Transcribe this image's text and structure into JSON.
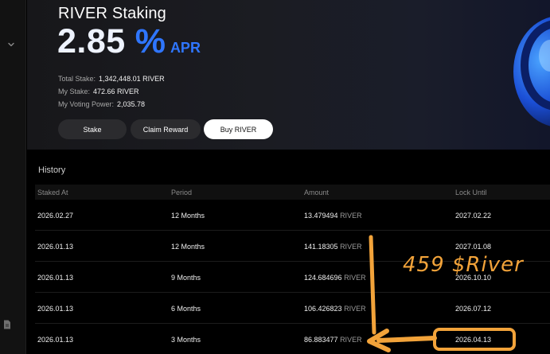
{
  "app": {
    "title": "RIVER Staking",
    "apr_value": "2.85",
    "apr_percent": "%",
    "apr_label": "APR",
    "accent_color": "#2f76ff"
  },
  "stats": {
    "total_stake_label": "Total Stake:",
    "total_stake_value": "1,342,448.01 RIVER",
    "my_stake_label": "My Stake:",
    "my_stake_value": "472.66 RIVER",
    "voting_power_label": "My Voting Power:",
    "voting_power_value": "2,035.78"
  },
  "actions": {
    "stake": "Stake",
    "claim_reward": "Claim Reward",
    "buy": "Buy RIVER"
  },
  "history": {
    "title": "History",
    "columns": [
      "Staked At",
      "Period",
      "Amount",
      "Lock Until"
    ],
    "rows": [
      {
        "staked_at": "2026.02.27",
        "period": "12 Months",
        "amount": "13.479494",
        "unit": "RIVER",
        "lock_until": "2027.02.22"
      },
      {
        "staked_at": "2026.01.13",
        "period": "12 Months",
        "amount": "141.18305",
        "unit": "RIVER",
        "lock_until": "2027.01.08"
      },
      {
        "staked_at": "2026.01.13",
        "period": "9 Months",
        "amount": "124.684696",
        "unit": "RIVER",
        "lock_until": "2026.10.10"
      },
      {
        "staked_at": "2026.01.13",
        "period": "6 Months",
        "amount": "106.426823",
        "unit": "RIVER",
        "lock_until": "2026.07.12"
      },
      {
        "staked_at": "2026.01.13",
        "period": "3 Months",
        "amount": "86.883477",
        "unit": "RIVER",
        "lock_until": "2026.04.13"
      }
    ]
  },
  "annotation": {
    "text": "459 $River",
    "color": "#f2a33a"
  },
  "icons": [
    "chevron-down-icon",
    "document-icon",
    "river-logo"
  ]
}
